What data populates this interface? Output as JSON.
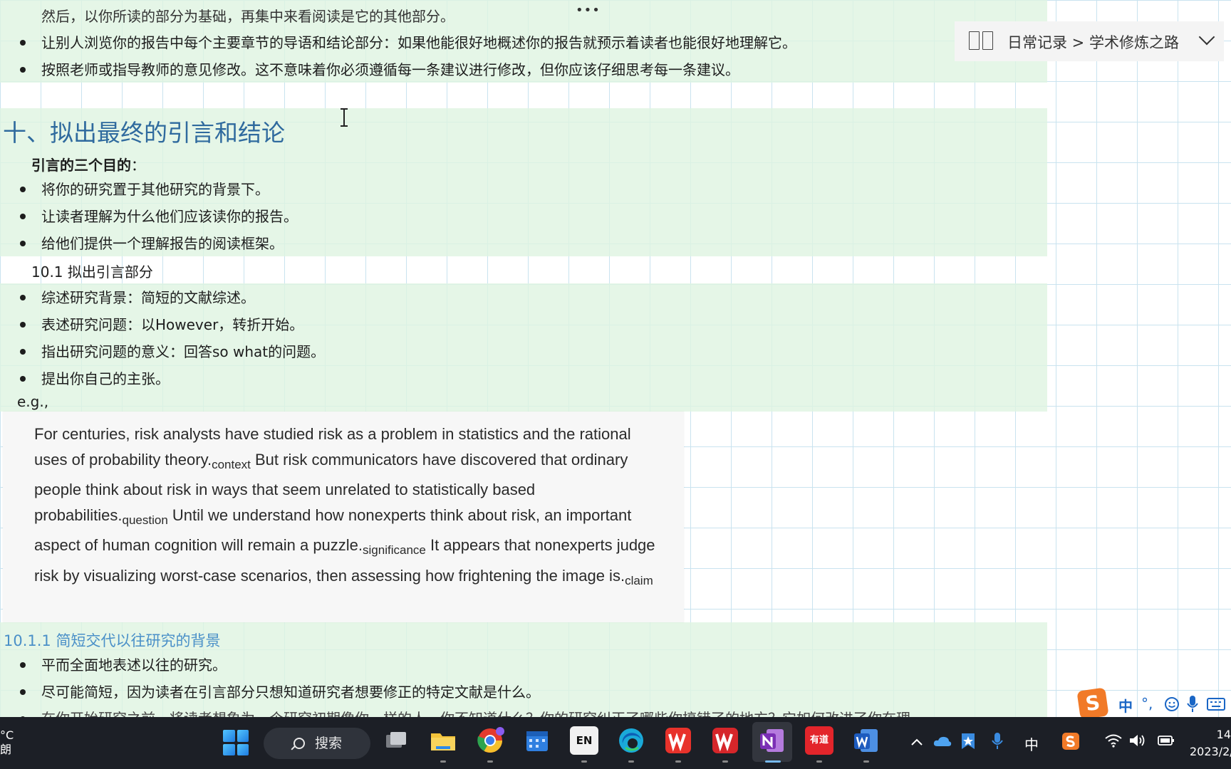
{
  "toolbar": {
    "more_label": "•••"
  },
  "breadcrumb": {
    "text": "日常记录 > 学术修炼之路"
  },
  "content": {
    "top_partial": "然后，以你所读的部分为基础，再集中来看阅读是它的其他部分。",
    "top_bullets": [
      "让别人浏览你的报告中每个主要章节的导语和结论部分：如果他能很好地概述你的报告就预示着读者也能很好地理解它。",
      "按照老师或指导教师的意见修改。这不意味着你必须遵循每一条建议进行修改，但你应该仔细思考每一条建议。"
    ],
    "heading": "十、拟出最终的引言和结论",
    "purposes_title": "引言的三个目的",
    "purposes_colon": "：",
    "purposes": [
      "将你的研究置于其他研究的背景下。",
      "让读者理解为什么他们应该读你的报告。",
      "给他们提供一个理解报告的阅读框架。"
    ],
    "sub_heading": "10.1 拟出引言部分",
    "steps": [
      "综述研究背景：简短的文献综述。",
      "表述研究问题：以However，转折开始。",
      "指出研究问题的意义：回答so what的问题。",
      "提出你自己的主张。"
    ],
    "eg_label": "e.g.,",
    "example": {
      "s1": "For centuries, risk analysts have studied risk as a problem in statistics and the rational uses of probability theory.",
      "t1": "context",
      "s2": " But risk communicators have discovered that ordinary people think about risk in ways that seem unrelated to statistically based probabilities.",
      "t2": "question",
      "s3": " Until we understand how nonexperts think about risk, an important aspect of human cognition will remain a puzzle.",
      "t3": "significance",
      "s4": " It appears that nonexperts judge risk by visualizing worst-case scenarios, then assessing how frightening the image is.",
      "t4": "claim"
    },
    "h3": "10.1.1 简短交代以往研究的背景",
    "bottom_bullets": [
      "平而全面地表述以往的研究。",
      "尽可能简短，因为读者在引言部分只想知道研究者想要修正的特定文献是什么。",
      "在你开始研究之前，将读者想象为一个研究初期像你一样的人，你不知道什么？你的研究纠正了哪些你搞错了的地方？它如何改进了你在理"
    ]
  },
  "ime": {
    "logo": "S",
    "mode": "中",
    "punct": "°,"
  },
  "taskbar": {
    "weather_temp": "°C",
    "weather_desc": "朗",
    "search_label": "搜索",
    "en_label": "EN",
    "youdao_label": "有道",
    "tray_lang": "中",
    "time": "14",
    "date": "2023/2/"
  },
  "colors": {
    "heading": "#2f6a9e",
    "h3": "#4a90c8",
    "band": "#def4e1",
    "taskbar": "#1c1f26"
  }
}
